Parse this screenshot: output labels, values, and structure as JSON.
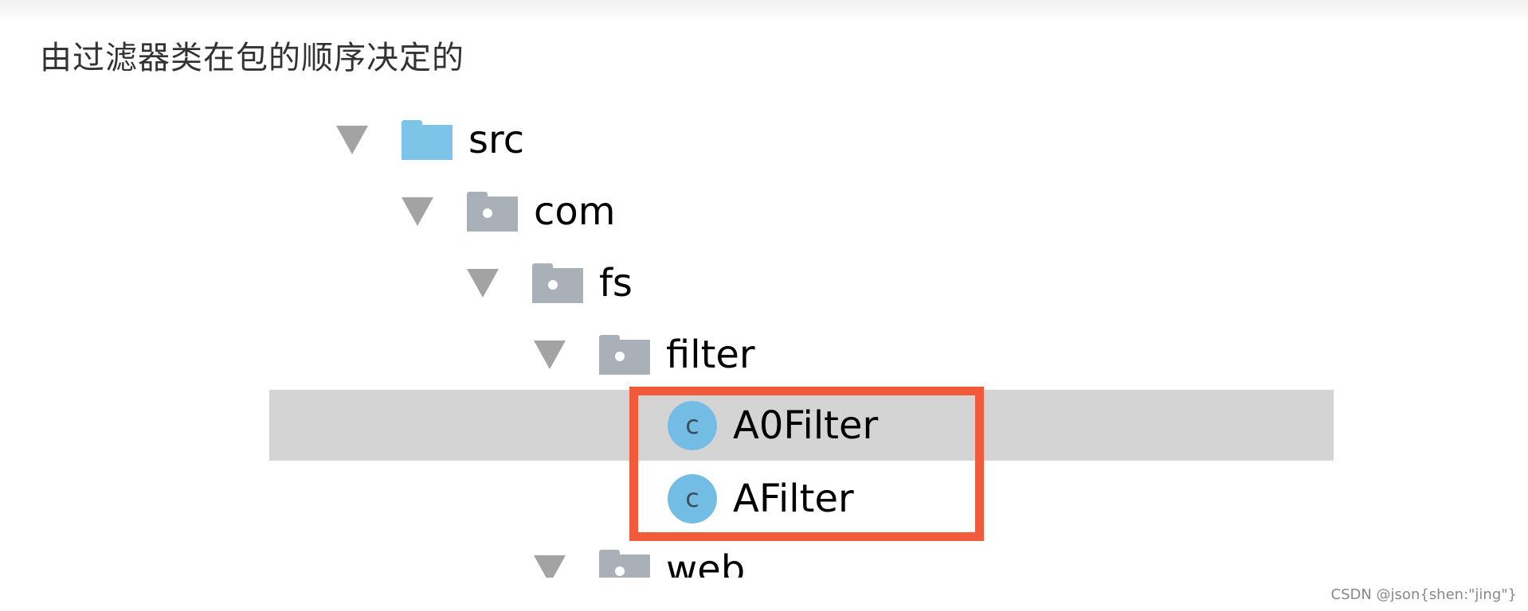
{
  "heading": "由过滤器类在包的顺序决定的",
  "tree": {
    "src": {
      "label": "src",
      "icon": "source-folder-icon"
    },
    "com": {
      "label": "com",
      "icon": "package-icon"
    },
    "fs": {
      "label": "fs",
      "icon": "package-icon"
    },
    "filter": {
      "label": "filter",
      "icon": "package-icon"
    },
    "a0filter": {
      "label": "A0Filter",
      "icon_letter": "c"
    },
    "afilter": {
      "label": "AFilter",
      "icon_letter": "c"
    },
    "web": {
      "label": "web",
      "icon": "package-icon"
    }
  },
  "colors": {
    "selection": "#d4d4d4",
    "highlight_box": "#f25a3c",
    "class_icon": "#73bde5",
    "source_folder": "#7cc5e8",
    "package_folder": "#a9b0b7"
  },
  "watermark": "CSDN @json{shen:\"jing\"}"
}
